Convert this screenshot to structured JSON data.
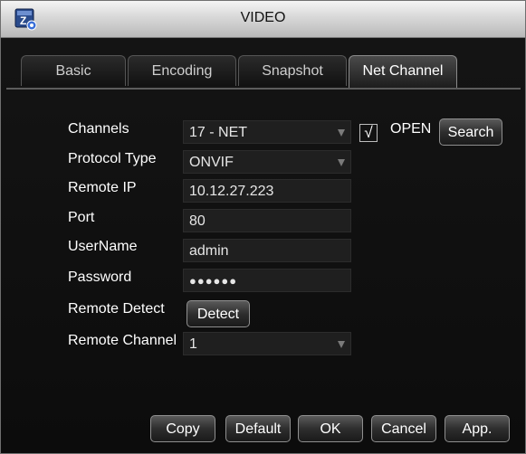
{
  "window": {
    "title": "VIDEO"
  },
  "tabs": [
    {
      "label": "Basic"
    },
    {
      "label": "Encoding"
    },
    {
      "label": "Snapshot"
    },
    {
      "label": "Net Channel",
      "active": true
    }
  ],
  "form": {
    "channels_label": "Channels",
    "channels_value": "17 - NET",
    "open_label": "OPEN",
    "open_checked": true,
    "search_label": "Search",
    "protocol_label": "Protocol Type",
    "protocol_value": "ONVIF",
    "remote_ip_label": "Remote IP",
    "remote_ip_value": "10.12.27.223",
    "port_label": "Port",
    "port_value": "80",
    "username_label": "UserName",
    "username_value": "admin",
    "password_label": "Password",
    "password_value": "●●●●●●",
    "remote_detect_label": "Remote Detect",
    "detect_label": "Detect",
    "remote_channel_label": "Remote Channel",
    "remote_channel_value": "1"
  },
  "footer": {
    "copy": "Copy",
    "default": "Default",
    "ok": "OK",
    "cancel": "Cancel",
    "apply": "App."
  },
  "icons": {
    "logo": "app-logo-icon",
    "dropdown": "chevron-down-icon",
    "check": "checkmark-icon"
  },
  "colors": {
    "window_bg": "#121212",
    "field_bg": "#1f1f1f",
    "titlebar": "#d8d8d8"
  }
}
